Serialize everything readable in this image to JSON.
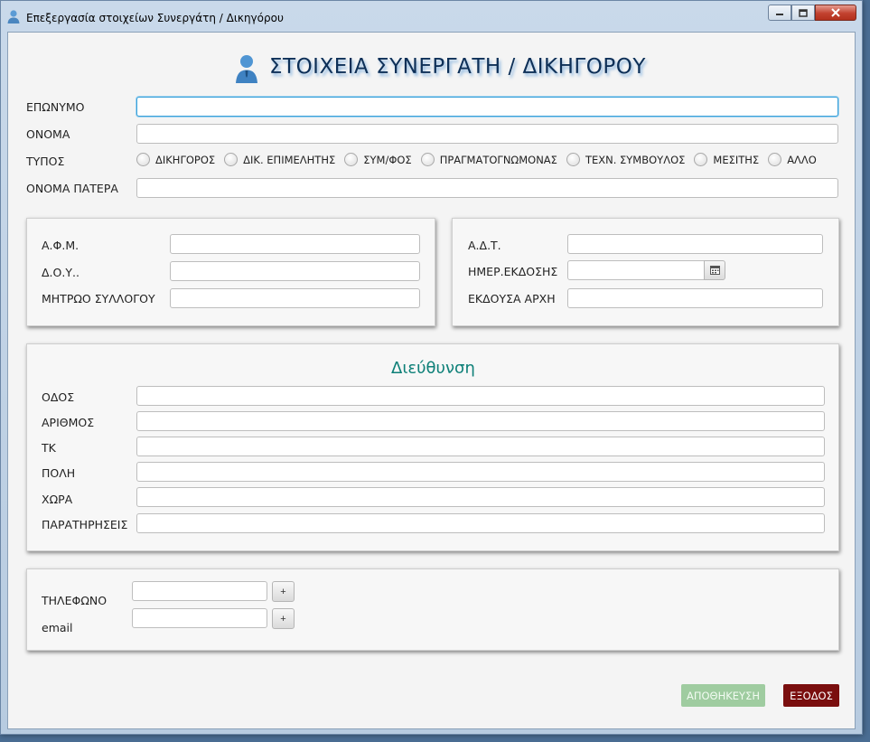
{
  "window": {
    "title": "Επεξεργασία στοιχείων Συνεργάτη / Δικηγόρου",
    "icon": "user-icon"
  },
  "header": {
    "title": "ΣΤΟΙΧΕΙΑ  ΣΥΝΕΡΓΑΤΗ / ΔΙΚΗΓΟΡΟΥ",
    "icon": "user-icon"
  },
  "personal": {
    "surname_label": "ΕΠΩΝΥΜΟ",
    "surname_value": "",
    "name_label": "ΟΝΟΜΑ",
    "name_value": "",
    "type_label": "ΤΥΠΟΣ",
    "types": [
      {
        "label": "ΔΙΚΗΓΟΡΟΣ",
        "selected": false
      },
      {
        "label": "ΔΙΚ. ΕΠΙΜΕΛΗΤΗΣ",
        "selected": false
      },
      {
        "label": "ΣΥΜ/ΦΟΣ",
        "selected": false
      },
      {
        "label": "ΠΡΑΓΜΑΤΟΓΝΩΜΟΝΑΣ",
        "selected": false
      },
      {
        "label": "ΤΕΧΝ. ΣΥΜΒΟΥΛΟΣ",
        "selected": false
      },
      {
        "label": "ΜΕΣΙΤΗΣ",
        "selected": false
      },
      {
        "label": "ΑΛΛΟ",
        "selected": false
      }
    ],
    "father_label": "ΟΝΟΜΑ ΠΑΤΕΡΑ",
    "father_value": ""
  },
  "tax": {
    "afm_label": "Α.Φ.Μ.",
    "doy_label": "Δ.Ο.Υ..",
    "registry_label": "ΜΗΤΡΩΟ ΣΥΛΛΟΓΟΥ"
  },
  "id_card": {
    "adt_label": "Α.Δ.Τ.",
    "issue_date_label": "ΗΜΕΡ.ΕΚΔΟΣΗΣ",
    "authority_label": "ΕΚΔΟΥΣΑ ΑΡΧΗ",
    "calendar_icon": "calendar-icon"
  },
  "address": {
    "title": "Διεύθυνση",
    "street_label": "ΟΔΟΣ",
    "number_label": "ΑΡΙΘΜΟΣ",
    "zip_label": "ΤΚ",
    "city_label": "ΠΟΛΗ",
    "country_label": "ΧΩΡΑ",
    "notes_label": "ΠΑΡΑΤΗΡΗΣΕΙΣ"
  },
  "contact": {
    "phone_label": "ΤΗΛΕΦΩΝΟ",
    "email_label": "email",
    "add_label": "+"
  },
  "actions": {
    "save_label": "ΑΠΟΘΗΚΕΥΣΗ",
    "exit_label": "ΕΞΟΔΟΣ"
  },
  "colors": {
    "save_bg": "#9fcca0",
    "exit_bg": "#7a0e0e",
    "section_title": "#0e8078",
    "focus_border": "#3aa0d8"
  }
}
